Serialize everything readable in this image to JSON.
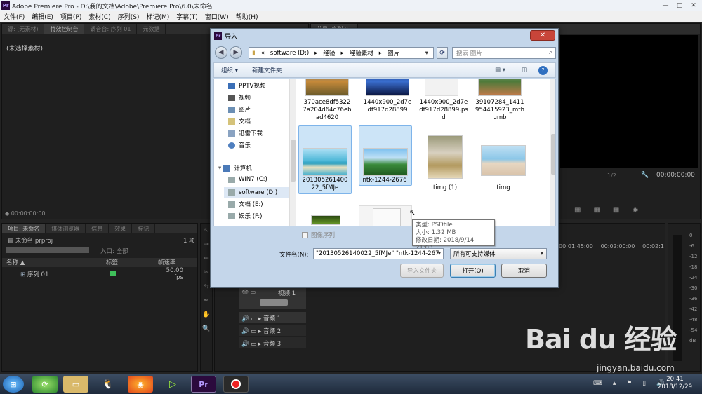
{
  "app": {
    "logo": "Pr",
    "title": "Adobe Premiere Pro - D:\\我的文档\\Adobe\\Premiere Pro\\6.0\\未命名",
    "window_buttons": [
      "—",
      "□",
      "✕"
    ]
  },
  "menu": [
    "文件(F)",
    "编辑(E)",
    "项目(P)",
    "素材(C)",
    "序列(S)",
    "标记(M)",
    "字幕(T)",
    "窗口(W)",
    "帮助(H)"
  ],
  "source_panel": {
    "tabs": [
      "源: (无素材)",
      "特效控制台",
      "调音台: 序列 01",
      "元数据"
    ],
    "empty_text": "(未选择素材)",
    "timecode": "00:00:00:00"
  },
  "program_panel": {
    "tab": "节目: 序列 01",
    "timecode": "00:00:00:00",
    "zoom": "1/2"
  },
  "project_panel": {
    "tabs": [
      "项目: 未命名",
      "媒体浏览器",
      "信息",
      "效果",
      "标记"
    ],
    "file": "未命名.prproj",
    "count": "1 项",
    "entry_label": "入口: 全部",
    "columns": [
      "名称",
      "标签",
      "帧速率"
    ],
    "row": {
      "name": "序列 01",
      "fps": "50.00 fps"
    }
  },
  "timeline": {
    "times": [
      "00:01:45:00",
      "00:02:00:00",
      "00:02:1"
    ],
    "tracks": [
      "视频 1",
      "音频 1",
      "音频 2",
      "音频 3"
    ]
  },
  "meter_labels": [
    "0",
    "-6",
    "-12",
    "-18",
    "-24",
    "-30",
    "-36",
    "-42",
    "-48",
    "-54",
    "dB"
  ],
  "dialog": {
    "title": "导入",
    "close": "✕",
    "address": [
      "«",
      "software (D:)",
      "▸",
      "经验",
      "▸",
      "经验素材",
      "▸",
      "图片"
    ],
    "search_placeholder": "搜索 图片",
    "organize": "组织 ▾",
    "new_folder": "新建文件夹",
    "nav_items": [
      "PPTV视频",
      "视频",
      "图片",
      "文档",
      "迅雷下载",
      "音乐",
      "计算机",
      "WIN7 (C:)",
      "software (D:)",
      "文档 (E:)",
      "娱乐 (F:)"
    ],
    "files": [
      {
        "name": "370ace8df5322\n7a204d64c76eb\nad4620",
        "selected": false
      },
      {
        "name": "1440x900_2d7e\ndf917d28899",
        "selected": false
      },
      {
        "name": "1440x900_2d7e\ndf917d28899.ps\nd",
        "selected": false
      },
      {
        "name": "39107284_1411\n954415923_mth\numb",
        "selected": false
      },
      {
        "name": "201305261400\n22_5fMJe",
        "selected": true
      },
      {
        "name": "ntk-1244-2676",
        "selected": true
      },
      {
        "name": "timg (1)",
        "selected": false
      },
      {
        "name": "timg",
        "selected": false
      }
    ],
    "tooltip": [
      "类型: PSDfile",
      "大小: 1.32 MB",
      "修改日期: 2018/9/14 21:03"
    ],
    "image_sequence": "图像序列",
    "filename_label": "文件名(N):",
    "filename_value": "\"20130526140022_5fMJe\" \"ntk-1244-267",
    "filetype": "所有可支持媒体",
    "import_folder": "导入文件夹",
    "open": "打开(O)",
    "cancel": "取消"
  },
  "taskbar": {
    "time": "20:41",
    "date": "2018/12/29"
  },
  "watermark": {
    "logo": "Bai du 经验",
    "url": "jingyan.baidu.com"
  },
  "colors": {
    "dialog_frame": "#c4d6ea",
    "selection": "#cce4f7",
    "close_button": "#c8453a",
    "premiere_bg": "#232323"
  }
}
